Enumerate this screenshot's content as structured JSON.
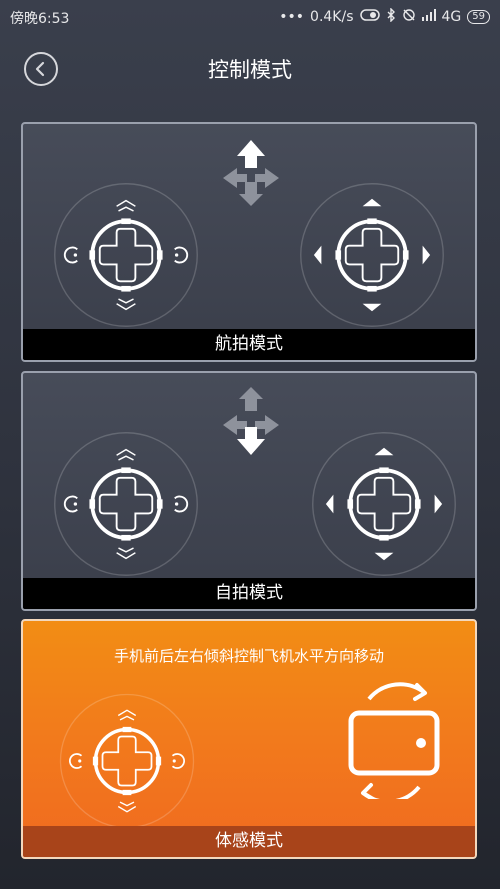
{
  "status_bar": {
    "time": "傍晚6:53",
    "network_speed": "0.4K/s",
    "network_type": "4G",
    "battery": "59"
  },
  "header": {
    "title": "控制模式"
  },
  "modes": [
    {
      "label": "航拍模式"
    },
    {
      "label": "自拍模式"
    },
    {
      "label": "体感模式",
      "hint": "手机前后左右倾斜控制飞机水平方向移动",
      "selected": true
    }
  ],
  "colors": {
    "accent": "#f28d14",
    "card_border": "#9aa0ad",
    "footer": "#000000"
  },
  "icons": [
    "back-icon",
    "move-arrows-icon",
    "joystick-icon",
    "phone-tilt-icon",
    "bluetooth-icon",
    "alarm-icon",
    "signal-icon",
    "battery-icon"
  ]
}
